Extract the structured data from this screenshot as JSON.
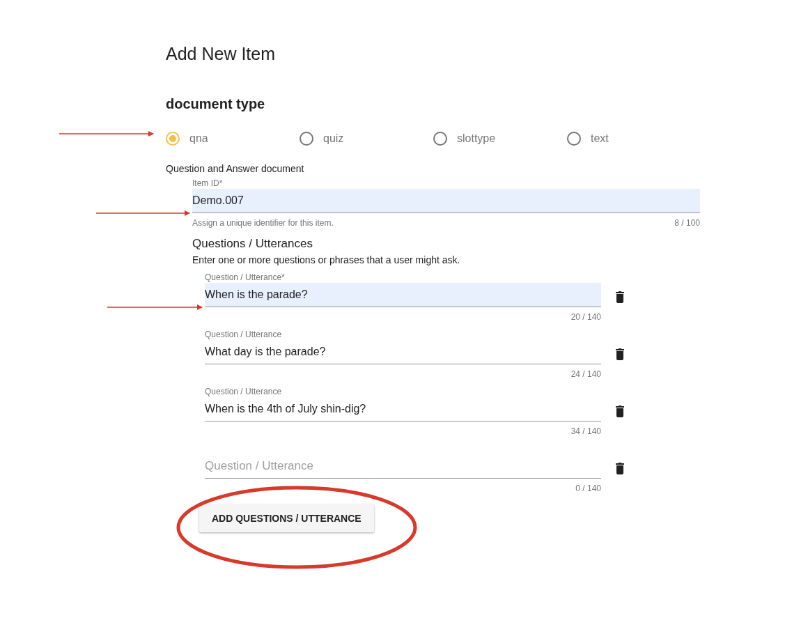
{
  "title": "Add New Item",
  "document_type": {
    "heading": "document type",
    "options": [
      {
        "label": "qna",
        "selected": true
      },
      {
        "label": "quiz",
        "selected": false
      },
      {
        "label": "slottype",
        "selected": false
      },
      {
        "label": "text",
        "selected": false
      }
    ]
  },
  "description": "Question and Answer document",
  "item_id": {
    "label": "Item ID*",
    "value": "Demo.007",
    "autofilled": true,
    "hint": "Assign a unique identifier for this item.",
    "counter": "8 / 100"
  },
  "questions": {
    "heading": "Questions / Utterances",
    "hint": "Enter one or more questions or phrases that a user might ask.",
    "fields": [
      {
        "label": "Question / Utterance*",
        "value": "When is the parade?",
        "autofilled": true,
        "counter": "20 / 140"
      },
      {
        "label": "Question / Utterance",
        "value": "What day is the parade?",
        "autofilled": false,
        "counter": "24 / 140"
      },
      {
        "label": "Question / Utterance",
        "value": "When is the 4th of July shin-dig?",
        "autofilled": false,
        "counter": "34 / 140"
      },
      {
        "placeholder": "Question / Utterance",
        "autofilled": false,
        "counter": "0 / 140"
      }
    ]
  },
  "add_button": "ADD QUESTIONS / UTTERANCE"
}
